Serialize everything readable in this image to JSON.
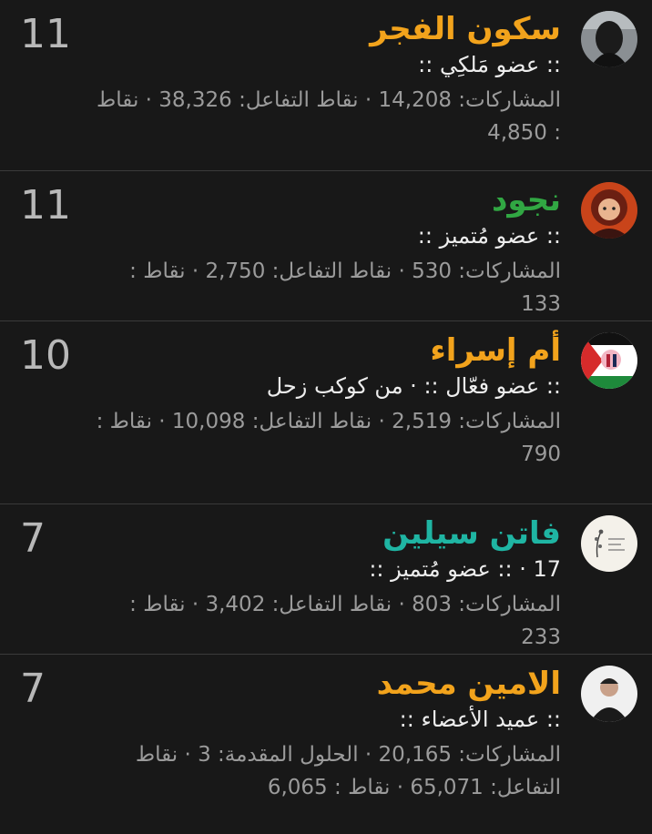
{
  "members": [
    {
      "name": "سكون الفجر",
      "name_color": "orange",
      "title": ":: عضو مَلكِي ::",
      "stats_text": "المشاركات: 14,208 · نقاط التفاعل: 38,326 · نقاط : 4,850",
      "count": "11",
      "avatar_icon": "veiled-woman-avatar"
    },
    {
      "name": "نجود",
      "name_color": "green",
      "title": ":: عضو مُتميز ::",
      "stats_text": "المشاركات: 530 · نقاط التفاعل: 2,750 · نقاط : 133",
      "count": "11",
      "avatar_icon": "child-in-hood-avatar"
    },
    {
      "name": "أم إسراء",
      "name_color": "orange",
      "title": ":: عضو فعّال :: · من كوكب زحل",
      "stats_text": "المشاركات: 2,519 · نقاط التفاعل: 10,098 · نقاط : 790",
      "count": "10",
      "avatar_icon": "palestine-flag-avatar"
    },
    {
      "name": "فاتن سيلين",
      "name_color": "teal",
      "title": "17 · :: عضو مُتميز ::",
      "stats_text": "المشاركات: 803 · نقاط التفاعل: 3,402 · نقاط : 233",
      "count": "7",
      "avatar_icon": "floral-signature-avatar"
    },
    {
      "name": "الامين محمد",
      "name_color": "orange",
      "title": ":: عميد الأعضاء ::",
      "stats_text": "المشاركات: 20,165 · الحلول المقدمة: 3 · نقاط التفاعل: 65,071 · نقاط : 6,065",
      "count": "7",
      "avatar_icon": "man-portrait-avatar"
    }
  ]
}
